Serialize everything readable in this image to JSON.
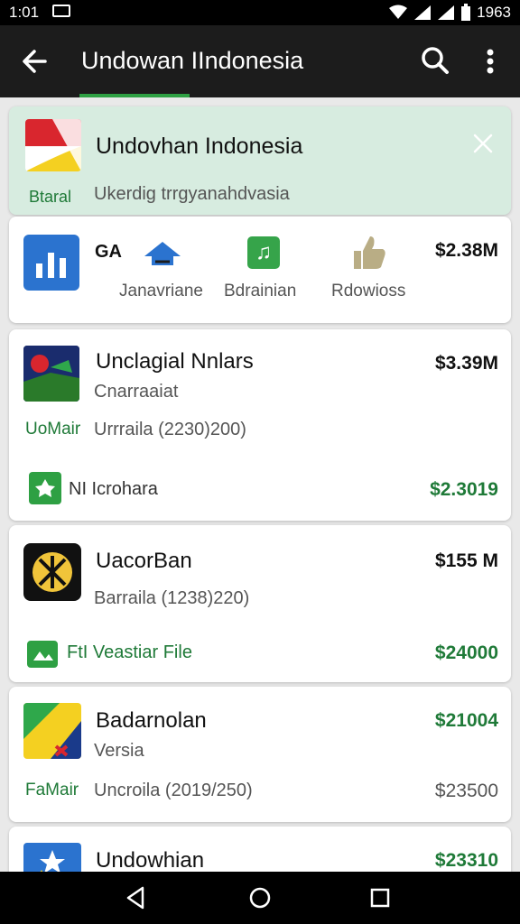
{
  "status_bar": {
    "time": "1:01",
    "right": "1963"
  },
  "app_bar": {
    "title": "Undowan IIndonesia"
  },
  "hero": {
    "title": "Undovhan Indonesia",
    "badge": "Btaral",
    "subtitle": "Ukerdig trrgyanahdvasia"
  },
  "stats": {
    "title": "GA",
    "labels": [
      "Janavriane",
      "Bdrainian",
      "Rdowioss"
    ],
    "price": "$2.38M"
  },
  "cards": [
    {
      "title": "Unclagial Nnlars",
      "subtitle": "Cnarraaiat",
      "tag": "UoMair",
      "detail": "Urrraila (2230)200)",
      "price": "$3.39M",
      "extra_label": "NI Icrohara",
      "extra_price": "$2.3019"
    },
    {
      "title": "UacorBan",
      "subtitle": "Barraila (1238)220)",
      "tag": "FtI Veastiar File",
      "price": "$155 M",
      "extra_price": "$24000"
    },
    {
      "title": "Badarnolan",
      "subtitle": "Versia",
      "tag": "FaMair",
      "detail": "Uncroila (2019/250)",
      "price": "$21004",
      "extra_price": "$23500"
    },
    {
      "title": "Undowhian",
      "price": "$23310"
    }
  ]
}
